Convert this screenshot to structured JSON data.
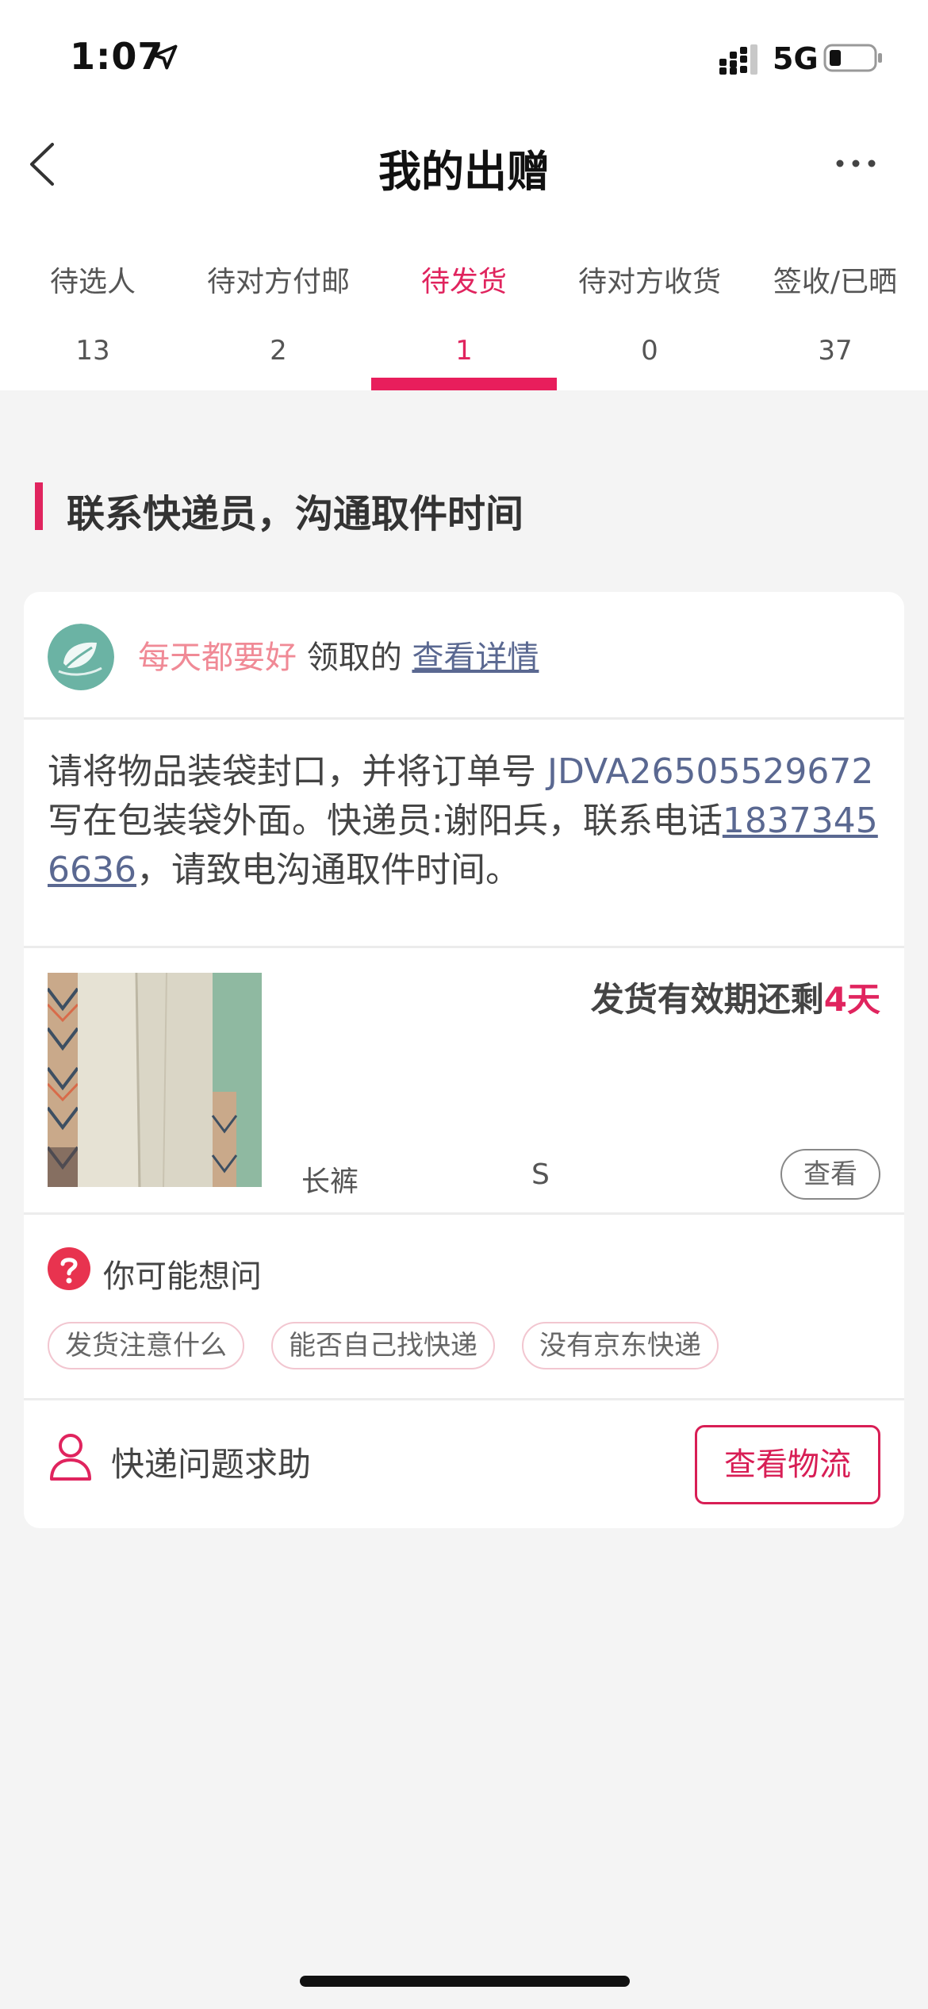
{
  "status_bar": {
    "time": "1:07",
    "network": "5G"
  },
  "nav": {
    "title": "我的出赠"
  },
  "tabs": [
    {
      "label": "待选人",
      "count": "13"
    },
    {
      "label": "待对方付邮",
      "count": "2"
    },
    {
      "label": "待发货",
      "count": "1",
      "active": true
    },
    {
      "label": "待对方收货",
      "count": "0"
    },
    {
      "label": "签收/已晒",
      "count": "37"
    }
  ],
  "section": {
    "heading": "联系快递员，沟通取件时间"
  },
  "card": {
    "receiver": {
      "name": "每天都要好",
      "suffix": " 领取的 ",
      "view_detail": "查看详情"
    },
    "instruction": {
      "prefix": "请将物品装袋封口，并将订单号 ",
      "order_no": "JDVA26505529672",
      "middle": " 写在包装袋外面。快递员:谢阳兵，联系电话",
      "phone": "18373456636",
      "suffix": "，请致电沟通取件时间。"
    },
    "item": {
      "deadline_prefix": "发货有效期还剩",
      "deadline_days": "4天",
      "name": "长裤",
      "size": "S",
      "view_label": "查看"
    },
    "faq": {
      "title": "你可能想问",
      "tags": [
        "发货注意什么",
        "能否自己找快递",
        "没有京东快递"
      ]
    },
    "help": {
      "label": "快递问题求助",
      "logistics_button": "查看物流"
    }
  },
  "colors": {
    "accent": "#e0245e",
    "link": "#5a6891",
    "receiver_name": "#f08a96"
  },
  "icons": {
    "back": "chevron-left-icon",
    "more": "more-horizontal-icon",
    "faq": "question-circle-icon",
    "help": "user-outline-icon",
    "avatar": "leaf-logo-avatar"
  }
}
